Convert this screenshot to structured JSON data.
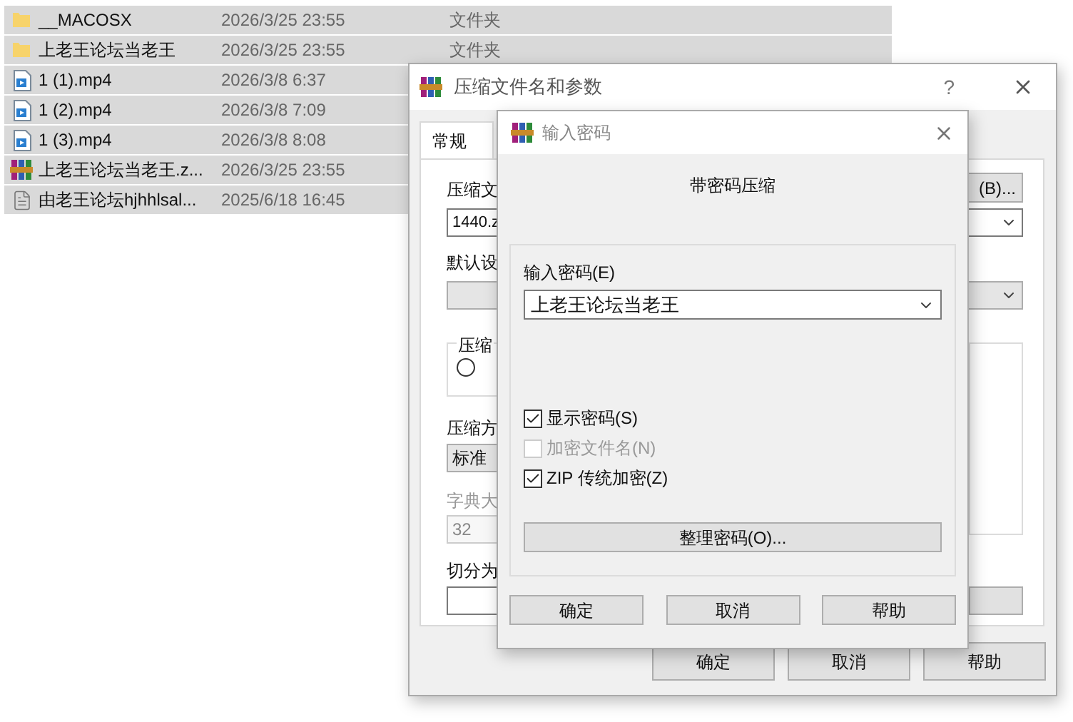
{
  "file_list": {
    "rows": [
      {
        "kind": "folder",
        "name": "__MACOSX",
        "date": "2026/3/25 23:55",
        "type": "文件夹",
        "selected": true
      },
      {
        "kind": "folder",
        "name": "上老王论坛当老王",
        "date": "2026/3/25 23:55",
        "type": "文件夹",
        "selected": true
      },
      {
        "kind": "video",
        "name": "1 (1).mp4",
        "date": "2026/3/8 6:37",
        "selected": true
      },
      {
        "kind": "video",
        "name": "1 (2).mp4",
        "date": "2026/3/8 7:09",
        "selected": true
      },
      {
        "kind": "video",
        "name": "1 (3).mp4",
        "date": "2026/3/8 8:08",
        "selected": true
      },
      {
        "kind": "archive",
        "name": "上老王论坛当老王.z...",
        "date": "2026/3/25 23:55",
        "selected": true
      },
      {
        "kind": "text",
        "name": "由老王论坛hjhhlsal...",
        "date": "2025/6/18 16:45",
        "selected": true
      }
    ]
  },
  "compress_dialog": {
    "title": "压缩文件名和参数",
    "help": "?",
    "tabs": [
      {
        "label": "常规",
        "selected": true
      }
    ],
    "archive_name_label": "压缩文",
    "browse_button": "(B)...",
    "archive_name": "1440.z",
    "profile_label": "默认设",
    "format_group_label": "压缩",
    "format_radio": {
      "selected": false
    },
    "method_label": "压缩方",
    "method": "标准",
    "dictionary": {
      "label": "字典大",
      "value": "32",
      "disabled": true
    },
    "split_label": "切分为",
    "buttons": [
      "确定",
      "取消",
      "帮助"
    ]
  },
  "password_dialog": {
    "title": "输入密码",
    "heading": "带密码压缩",
    "password_label": "输入密码(E)",
    "password": "上老王论坛当老王",
    "options": [
      {
        "label": "显示密码(S)",
        "checked": true,
        "disabled": false
      },
      {
        "label": "加密文件名(N)",
        "checked": false,
        "disabled": true
      },
      {
        "label": "ZIP 传统加密(Z)",
        "checked": true,
        "disabled": false
      }
    ],
    "organize_button": "整理密码(O)...",
    "buttons": [
      "确定",
      "取消",
      "帮助"
    ]
  }
}
